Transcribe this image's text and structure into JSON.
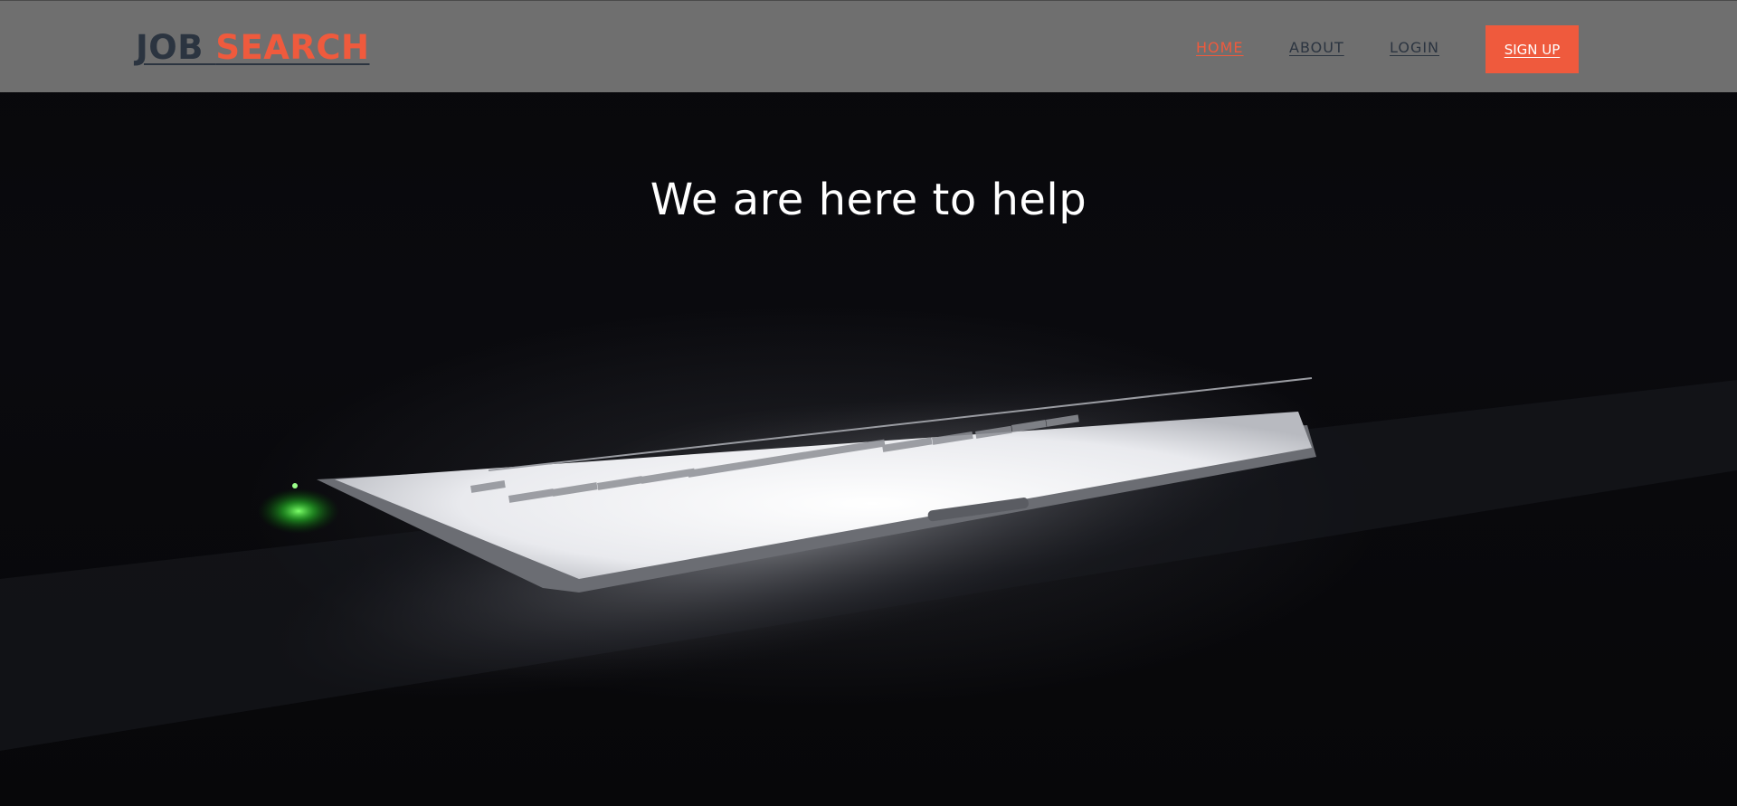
{
  "brand": {
    "part1": "JOB ",
    "part2": "SEARCH"
  },
  "nav": {
    "items": [
      {
        "label": "HOME",
        "active": true
      },
      {
        "label": "ABOUT",
        "active": false
      },
      {
        "label": "LOGIN",
        "active": false
      }
    ],
    "signup_label": "SIGN UP"
  },
  "hero": {
    "headline": "We are here to help",
    "image_subject": "glowing laptop on a dark desk"
  },
  "colors": {
    "accent": "#ef5a3d",
    "navbar_bg": "#808080",
    "nav_text": "#2b3440",
    "hero_bg": "#08080b"
  }
}
